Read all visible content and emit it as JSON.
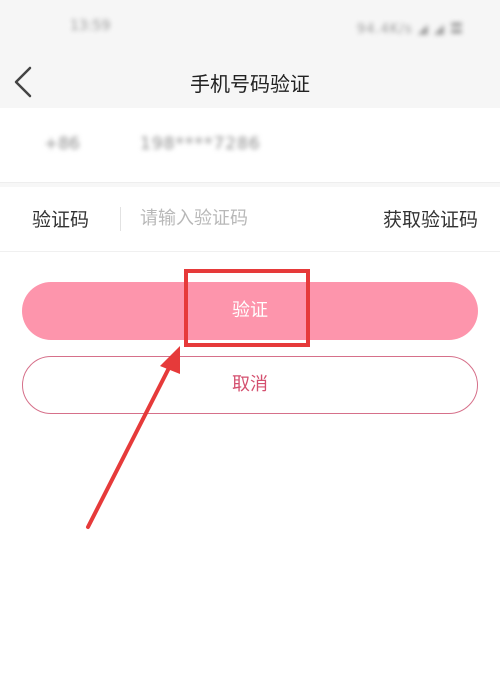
{
  "status_bar": {
    "time": "13:59",
    "icons": "94.4K/s ◢ ◢ 〓"
  },
  "nav": {
    "title": "手机号码验证",
    "back_icon": "chevron-left-icon"
  },
  "phone": {
    "country_code": "+86",
    "number": "198****7286"
  },
  "code_field": {
    "label": "验证码",
    "placeholder": "请输入验证码",
    "value": "",
    "get_code_label": "获取验证码"
  },
  "buttons": {
    "verify_label": "验证",
    "cancel_label": "取消"
  },
  "colors": {
    "accent": "#fd95ac",
    "cancel_text": "#d4506f",
    "annotation": "#e63a3a"
  }
}
